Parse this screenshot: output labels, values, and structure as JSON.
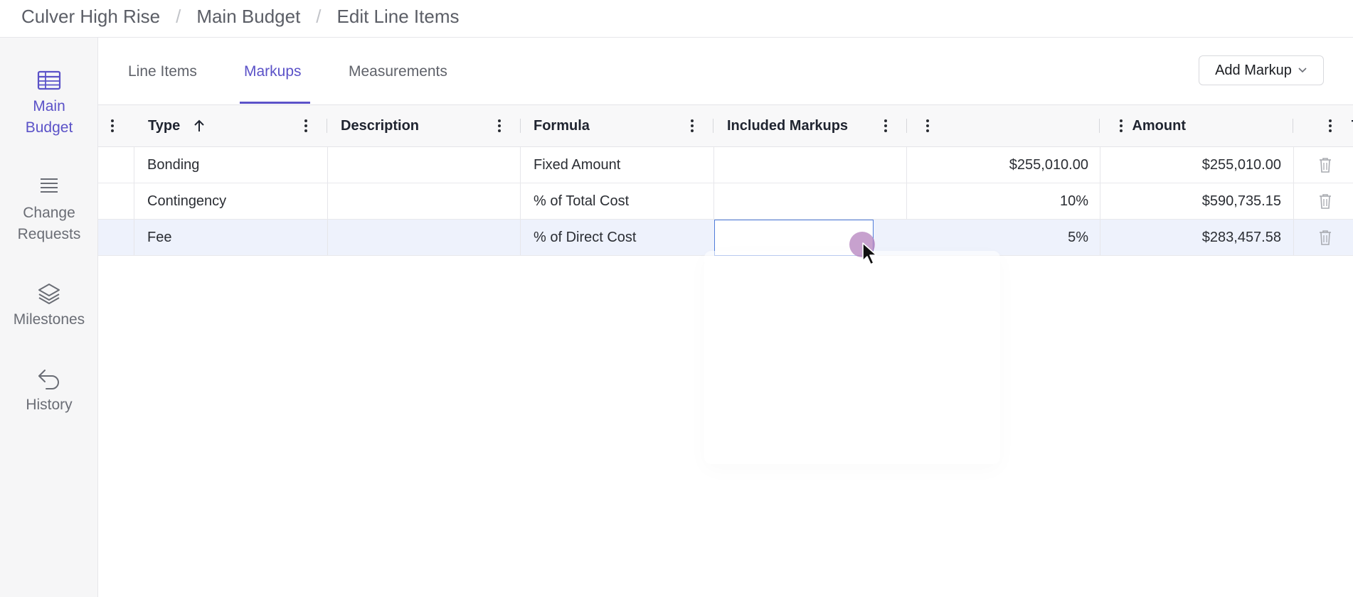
{
  "breadcrumb": [
    "Culver High Rise",
    "Main Budget",
    "Edit Line Items"
  ],
  "sidebar": {
    "items": [
      {
        "label": "Main Budget",
        "icon": "table-icon",
        "active": true
      },
      {
        "label": "Change Requests",
        "icon": "list-icon",
        "active": false
      },
      {
        "label": "Milestones",
        "icon": "layers-icon",
        "active": false
      },
      {
        "label": "History",
        "icon": "undo-arrow-icon",
        "active": false
      }
    ]
  },
  "tabs": [
    {
      "label": "Line Items",
      "active": false
    },
    {
      "label": "Markups",
      "active": true
    },
    {
      "label": "Measurements",
      "active": false
    }
  ],
  "add_markup_label": "Add Markup",
  "table": {
    "columns": [
      "Type",
      "Description",
      "Formula",
      "Included Markups",
      "Amount",
      "Total"
    ],
    "rows": [
      {
        "type": "Bonding",
        "description": "",
        "formula": "Fixed Amount",
        "included": "",
        "amount": "$255,010.00",
        "total": "$255,010.00"
      },
      {
        "type": "Contingency",
        "description": "",
        "formula": "% of Total Cost",
        "included": "",
        "amount": "10%",
        "total": "$590,735.15"
      },
      {
        "type": "Fee",
        "description": "",
        "formula": "% of Direct Cost",
        "included": "",
        "amount": "5%",
        "total": "$283,457.58"
      }
    ]
  },
  "colors": {
    "accent": "#5b52c8",
    "selected_row": "#eef2fc",
    "focus_border": "#4f7cd9"
  }
}
